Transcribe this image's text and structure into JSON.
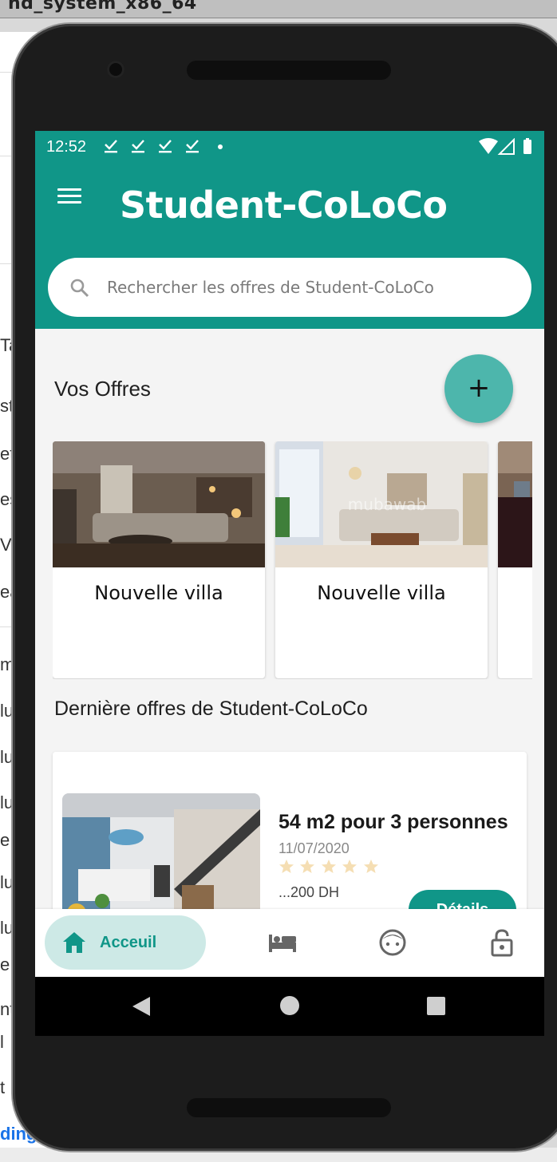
{
  "desktop": {
    "window_title": "nd_system_x86_64",
    "fragments": [
      "Ta",
      "st",
      "et",
      "es",
      "Vr",
      "ea",
      "m",
      "lu",
      "lu",
      "lu",
      "e",
      "lu",
      "lu",
      "e",
      "nt",
      "l",
      "t"
    ],
    "bottom_link": "ding"
  },
  "status_bar": {
    "time": "12:52"
  },
  "app_bar": {
    "title": "Student-CoLoCo"
  },
  "search": {
    "placeholder": "Rechercher les offres de Student-CoLoCo"
  },
  "your_offers": {
    "title": "Vos Offres",
    "add_button_label": "+",
    "items": [
      {
        "label": "Nouvelle villa"
      },
      {
        "label": "Nouvelle villa"
      },
      {
        "label": ""
      }
    ]
  },
  "latest_offers": {
    "title": "Dernière offres de Student-CoLoCo",
    "items": [
      {
        "title": "54 m2 pour 3 personnes",
        "date": "11/07/2020",
        "rating": 0,
        "rating_max": 5,
        "price": "...200 DH",
        "details_label": "Détails"
      }
    ]
  },
  "watermark": "mubawab",
  "bottom_nav": {
    "items": [
      {
        "label": "Acceuil",
        "icon": "home-icon",
        "active": true
      },
      {
        "label": "",
        "icon": "bed-icon",
        "active": false
      },
      {
        "label": "",
        "icon": "face-icon",
        "active": false
      },
      {
        "label": "",
        "icon": "lock-icon",
        "active": false
      }
    ]
  },
  "colors": {
    "primary": "#109688",
    "fab": "#4db6ac",
    "nav_active_bg": "#cde9e6",
    "background": "#f4f4f4",
    "star_empty": "#f5deb3"
  }
}
